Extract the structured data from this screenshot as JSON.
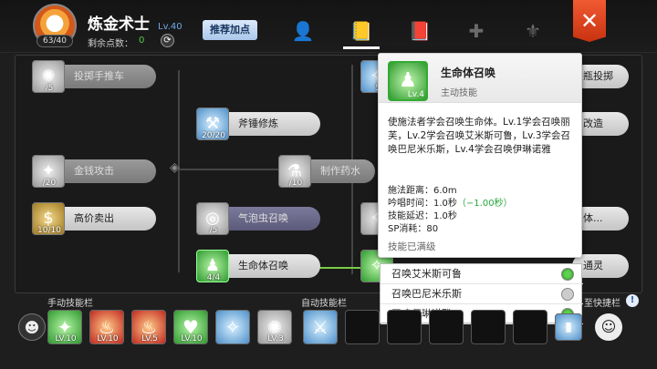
{
  "header": {
    "job_title": "炼金术士",
    "job_level": "Lv.40",
    "avatar_count": "63/40",
    "sp_label": "剩余点数：",
    "sp_value": "0",
    "recommend_button": "推荐加点",
    "tabs": [
      "person-star-icon",
      "skill-book-icon",
      "book-icon",
      "cross-icon",
      "wing-crest-icon"
    ],
    "close_glyph": "✕"
  },
  "tree": {
    "skills": [
      {
        "label": "投掷手推车",
        "level": "/5"
      },
      {
        "label": "斧锤修炼",
        "level": "20/20"
      },
      {
        "label": "金钱攻击",
        "level": "/20"
      },
      {
        "label": "制作药水",
        "level": "/10"
      },
      {
        "label": "高价卖出",
        "level": "10/10"
      },
      {
        "label": "气泡虫召唤",
        "level": "/5"
      },
      {
        "label": "生命体召唤",
        "level": "4/4"
      },
      {
        "label": "",
        "level": "5"
      },
      {
        "label": "瓶投掷",
        "level": ""
      },
      {
        "label": "改造",
        "level": ""
      },
      {
        "label": "体...",
        "level": ""
      },
      {
        "label": "通灵",
        "level": ""
      }
    ]
  },
  "tooltip": {
    "name": "生命体召唤",
    "type": "主动技能",
    "icon_level": "Lv.4",
    "description": "使施法者学会召唤生命体。Lv.1学会召唤丽芙，Lv.2学会召唤艾米斯可鲁，Lv.3学会召唤巴尼米乐斯，Lv.4学会召唤伊琳诺雅",
    "range": "施法距离：6.0m",
    "cast_time": "吟唱时间：1.0秒",
    "cast_bonus": "（−1.00秒）",
    "delay": "技能延迟：1.0秒",
    "sp_cost": "SP消耗：80",
    "maxed": "技能已满级"
  },
  "summons": [
    {
      "name": "召唤艾米斯可鲁",
      "active": true
    },
    {
      "name": "召唤巴尼米乐斯",
      "active": false
    },
    {
      "name": "召唤伊琳诺雅",
      "active": true
    }
  ],
  "bottom": {
    "manual_label": "手动技能栏",
    "auto_label": "自动技能栏",
    "shortcut_label": "至快捷栏",
    "manual_slots": [
      "LV.10",
      "LV.10",
      "LV.5",
      "LV.10",
      "",
      "LV.3"
    ],
    "info_glyph": "!"
  },
  "colors": {
    "accent": "#f05a32",
    "green": "#5ed14e",
    "level_blue": "#6fa9e6"
  }
}
